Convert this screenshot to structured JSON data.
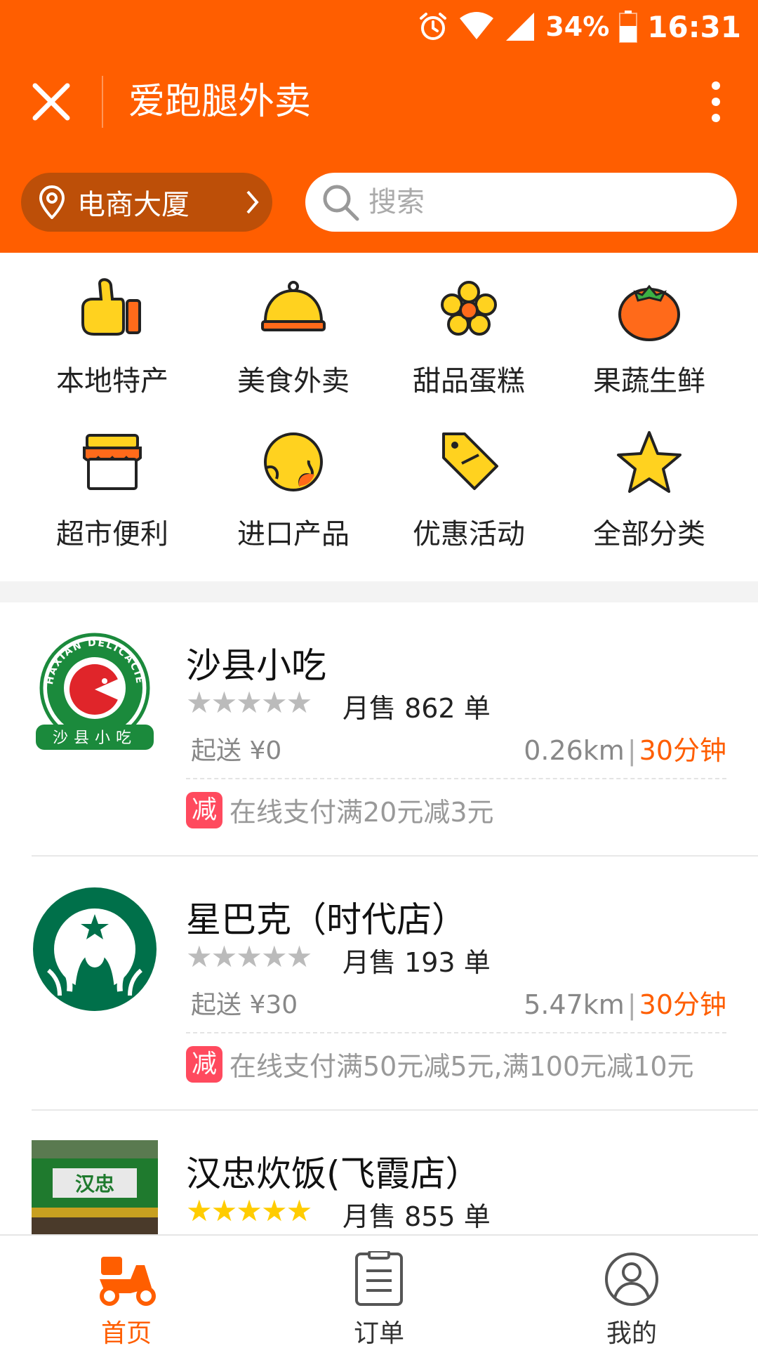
{
  "status": {
    "battery": "34%",
    "time": "16:31"
  },
  "header": {
    "title": "爱跑腿外卖",
    "location": "电商大厦",
    "search_placeholder": "搜索"
  },
  "categories": [
    {
      "label": "本地特产",
      "icon": "thumbs-up-icon"
    },
    {
      "label": "美食外卖",
      "icon": "food-cloche-icon"
    },
    {
      "label": "甜品蛋糕",
      "icon": "flower-icon"
    },
    {
      "label": "果蔬生鲜",
      "icon": "tomato-icon"
    },
    {
      "label": "超市便利",
      "icon": "store-icon"
    },
    {
      "label": "进口产品",
      "icon": "globe-icon"
    },
    {
      "label": "优惠活动",
      "icon": "coupon-tag-icon"
    },
    {
      "label": "全部分类",
      "icon": "star-icon"
    }
  ],
  "shops": [
    {
      "name": "沙县小吃",
      "stars": "★★★★★",
      "sales": "月售 862 单",
      "min_order": "起送 ¥0",
      "distance": "0.26km",
      "sep": "|",
      "time": "30分钟",
      "badge": "减",
      "promo": "在线支付满20元减3元"
    },
    {
      "name": "星巴克（时代店）",
      "stars": "★★★★★",
      "sales": "月售 193 单",
      "min_order": "起送 ¥30",
      "distance": "5.47km",
      "sep": "|",
      "time": "30分钟",
      "badge": "减",
      "promo": "在线支付满50元减5元,满100元减10元"
    },
    {
      "name": "汉忠炊饭(飞霞店）",
      "stars": "★★★★★",
      "sales": "月售 855 单"
    }
  ],
  "logos": {
    "shaxian_top": "SHAXIAN DELICACIES",
    "shaxian_bottom": "沙县小吃",
    "hanzhong_sign": "汉忠"
  },
  "bottom_nav": [
    {
      "label": "首页",
      "icon": "scooter-icon",
      "active": true
    },
    {
      "label": "订单",
      "icon": "order-list-icon",
      "active": false
    },
    {
      "label": "我的",
      "icon": "user-icon",
      "active": false
    }
  ],
  "colors": {
    "brand": "#ff5e00",
    "badge": "#ff4a5e",
    "star_gold": "#ffcc00"
  }
}
